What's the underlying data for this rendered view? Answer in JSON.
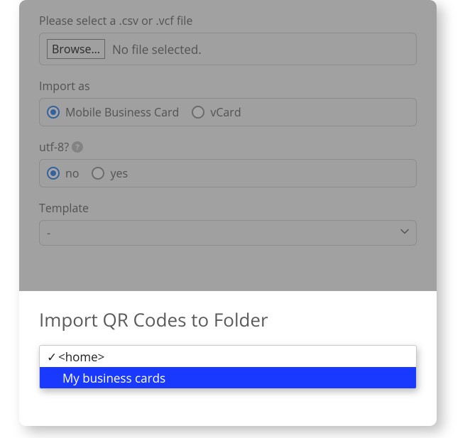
{
  "file_select": {
    "label": "Please select a .csv or .vcf file",
    "button": "Browse…",
    "status": "No file selected."
  },
  "import_as": {
    "label": "Import as",
    "options": [
      "Mobile Business Card",
      "vCard"
    ],
    "selected": "Mobile Business Card"
  },
  "utf8": {
    "label": "utf-8?",
    "options": [
      "no",
      "yes"
    ],
    "selected": "no"
  },
  "template": {
    "label": "Template",
    "value": "-"
  },
  "folder": {
    "title": "Import QR Codes to Folder",
    "options": [
      {
        "label": "<home>",
        "indent": 0,
        "selected": true,
        "highlight": false
      },
      {
        "label": "My business cards",
        "indent": 1,
        "selected": false,
        "highlight": true
      }
    ]
  }
}
